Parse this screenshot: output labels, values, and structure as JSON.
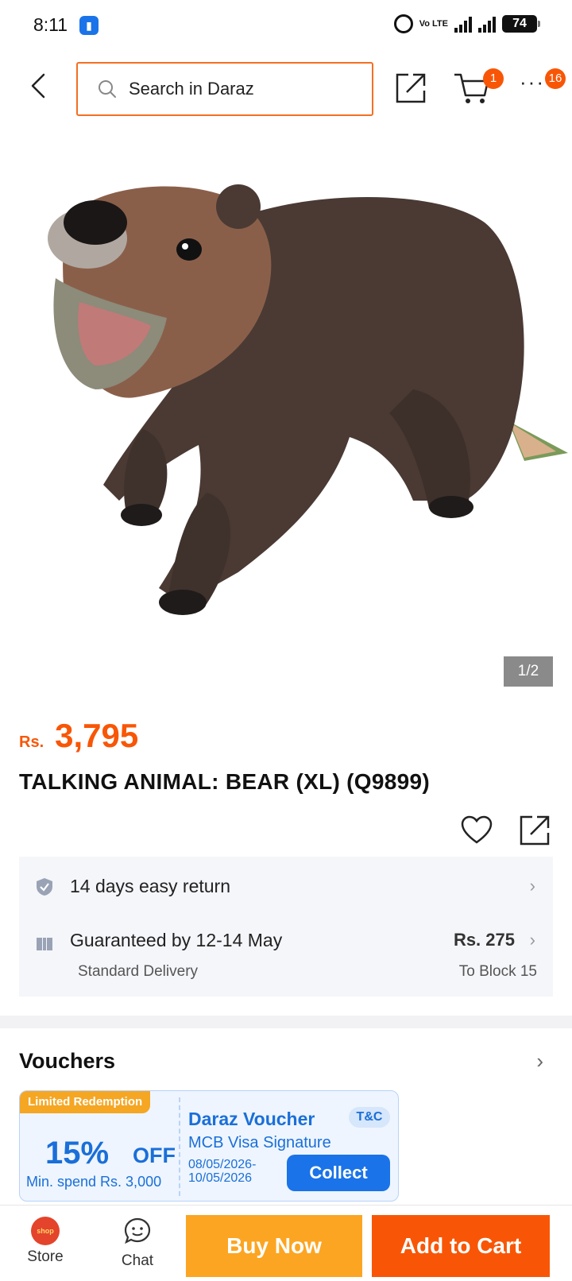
{
  "status_bar": {
    "time": "8:11",
    "battery": "74",
    "network_label": "Vo LTE"
  },
  "header": {
    "search_placeholder": "Search in Daraz",
    "cart_count": "1",
    "more_count": "16"
  },
  "gallery": {
    "counter": "1/2"
  },
  "product": {
    "currency": "Rs.",
    "price": "3,795",
    "title": "TALKING ANIMAL: BEAR (XL) (Q9899)"
  },
  "services": {
    "return_text": "14 days easy return",
    "delivery_text": "Guaranteed by 12-14 May",
    "delivery_sub": "Standard Delivery",
    "delivery_fee": "Rs. 275",
    "delivery_location": "To Block 15"
  },
  "vouchers": {
    "title": "Vouchers",
    "card": {
      "tag": "Limited Redemption",
      "percent": "15%",
      "off": "OFF",
      "min_spend": "Min. spend Rs. 3,000",
      "name": "Daraz Voucher",
      "tc": "T&C",
      "card_type": "MCB Visa Signature",
      "dates": "08/05/2026-10/05/2026",
      "collect_label": "Collect"
    }
  },
  "bottom_bar": {
    "store_label": "Store",
    "chat_label": "Chat",
    "buy_now_label": "Buy Now",
    "add_to_cart_label": "Add to Cart"
  },
  "colors": {
    "brand_orange": "#f85606",
    "buy_now": "#fca522",
    "voucher_blue": "#1a6fd8"
  }
}
